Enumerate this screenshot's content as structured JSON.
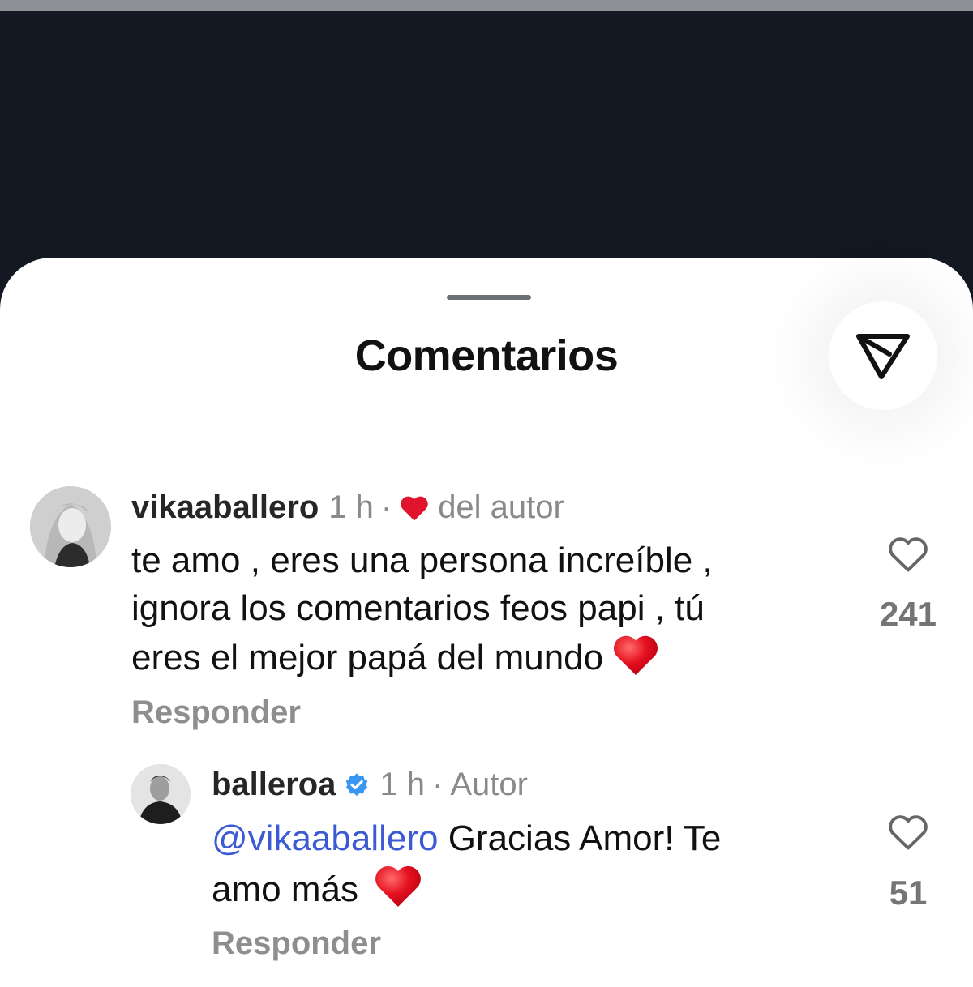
{
  "sheet": {
    "title": "Comentarios"
  },
  "comments": [
    {
      "username": "vikaaballero",
      "time": "1 h",
      "separator": "·",
      "author_like_label": "del autor",
      "text_lines": [
        "te amo , eres una persona increíble ,",
        "ignora los comentarios feos papi , tú",
        "eres el mejor papá del mundo"
      ],
      "reply_label": "Responder",
      "likes": "241"
    },
    {
      "username": "balleroa",
      "verified": true,
      "time": "1 h",
      "separator": "·",
      "role_label": "Autor",
      "mention": "@vikaaballero",
      "text_line1_rest": "Gracias Amor! Te",
      "text_line2": "amo más",
      "reply_label": "Responder",
      "likes": "51"
    }
  ],
  "icons": {
    "share": "paper-plane-icon",
    "like": "heart-outline-icon",
    "author_like": "red-heart-icon",
    "emoji": "red-heart-emoji",
    "verified": "verified-badge-icon"
  },
  "colors": {
    "backdrop": "#141823",
    "mention": "#3b5ad3",
    "heart": "#e0142d",
    "verified": "#3897f0"
  }
}
